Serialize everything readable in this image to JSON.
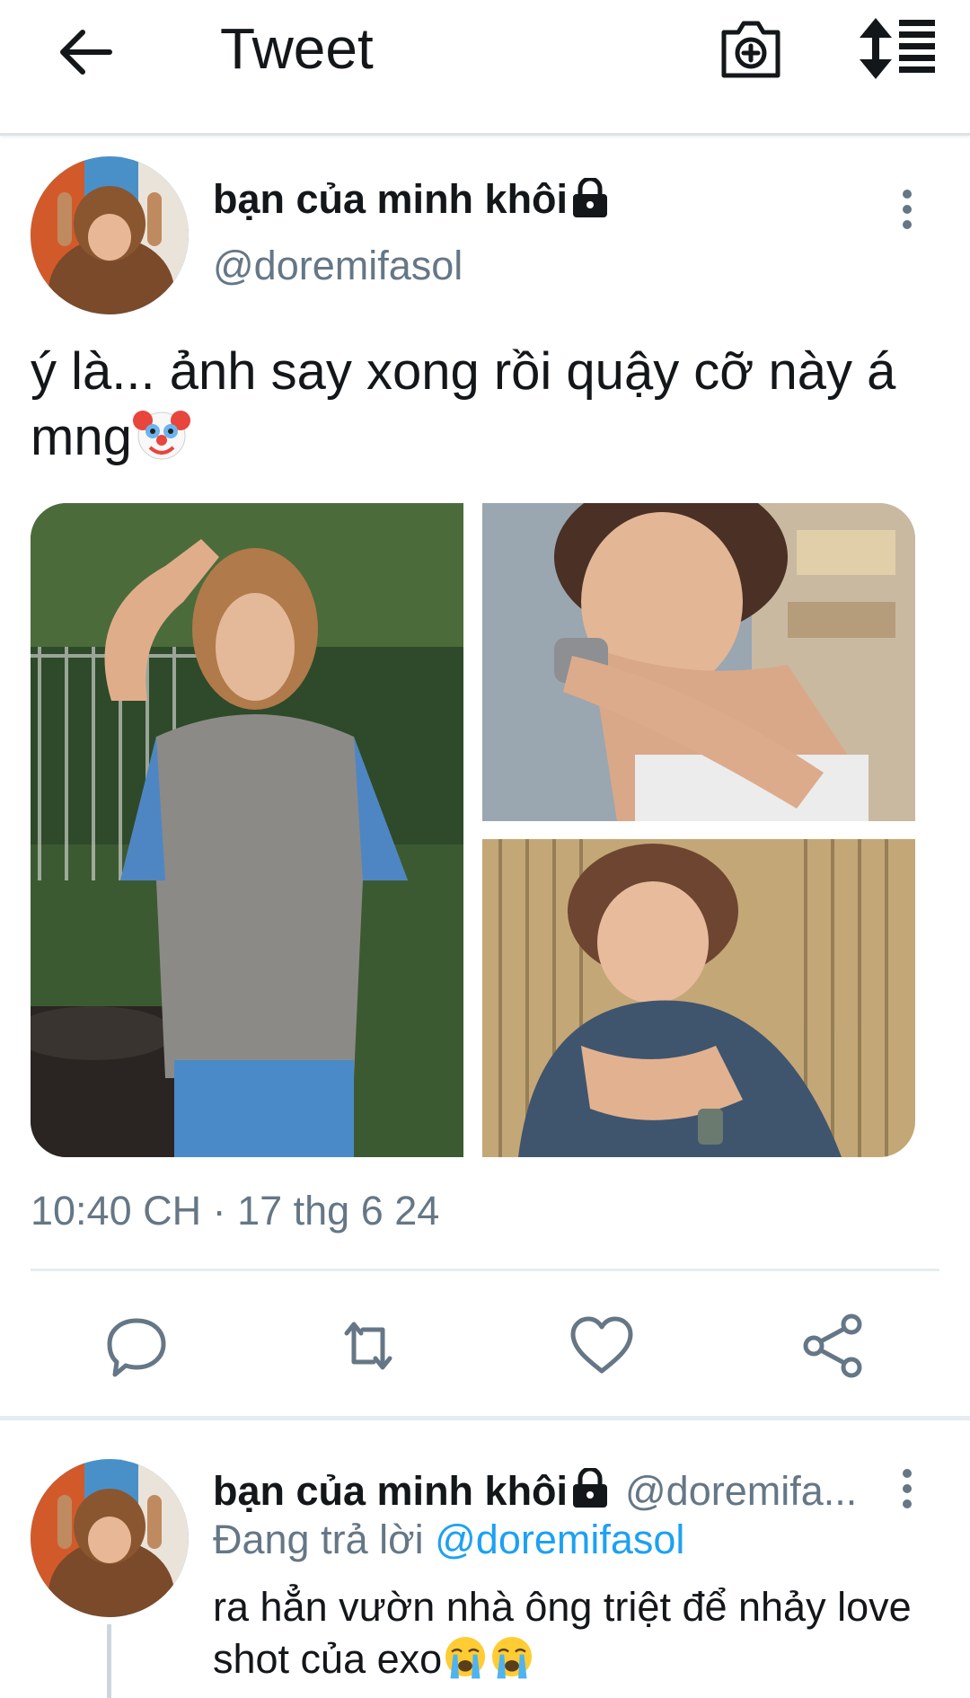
{
  "header": {
    "title": "Tweet",
    "back_icon": "arrow-left-icon",
    "camera_icon": "camera-plus-icon",
    "sort_icon": "sort-lines-icon"
  },
  "tweet": {
    "author_name": "bạn của minh khôi",
    "handle": "@doremifasol",
    "text_main": "ý là... ảnh say xong rồi quậy cỡ này á mng",
    "text_emoji": "clown-face-emoji",
    "timestamp": "10:40 CH · 17 thg 6 24",
    "media_count": 3
  },
  "actions": {
    "reply_icon": "reply-bubble-icon",
    "retweet_icon": "retweet-icon",
    "like_icon": "heart-icon",
    "share_icon": "share-icon"
  },
  "reply": {
    "author_name": "bạn của minh khôi",
    "handle": "@doremifa...",
    "replying_prefix": "Đang trả lời",
    "replying_handle": "@doremifasol",
    "text": "ra hẳn vườn nhà ông triệt để nhảy love shot của exo",
    "text_emoji": "crying-face-emoji"
  },
  "colors": {
    "primary_text": "#14171a",
    "secondary_text": "#657786",
    "accent": "#1da1f2",
    "divider": "#e6ecf0"
  }
}
